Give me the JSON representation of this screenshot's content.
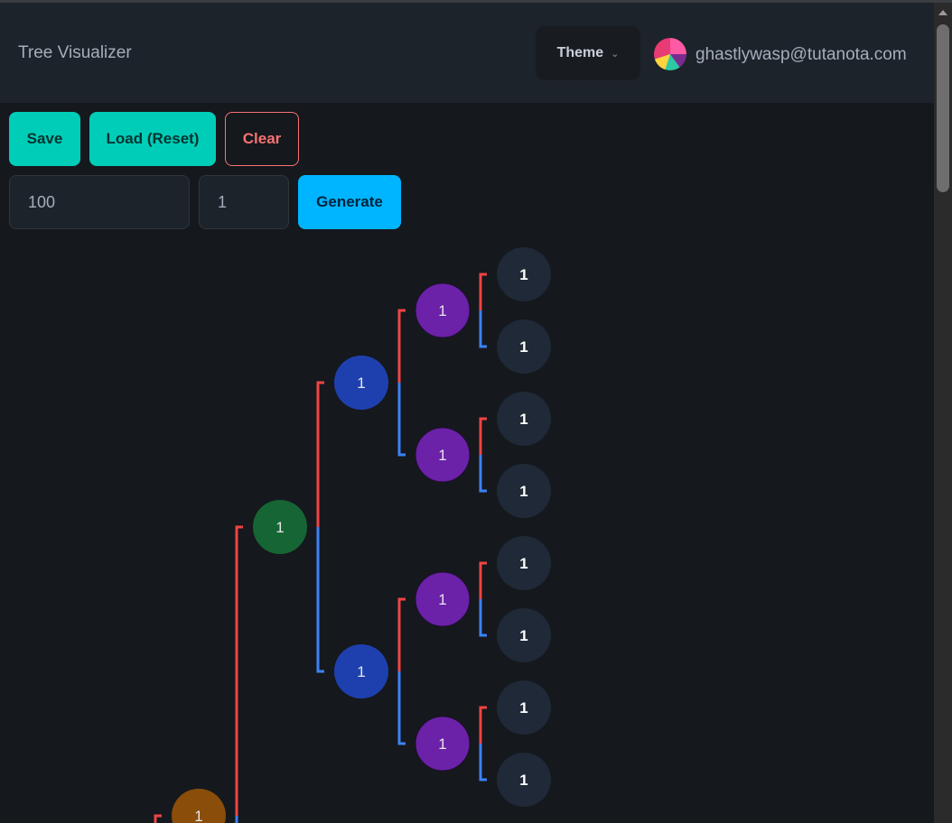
{
  "navbar": {
    "title": "Tree Visualizer",
    "theme_label": "Theme",
    "user_email": "ghastlywasp@tutanota.com"
  },
  "toolbar": {
    "save_label": "Save",
    "load_label": "Load (Reset)",
    "clear_label": "Clear",
    "generate_label": "Generate",
    "size_value": "100",
    "seed_value": "1"
  },
  "colors": {
    "left_branch": "#ef4444",
    "right_branch": "#3b82f6",
    "depth0": "#8a4d0a",
    "depth1": "#166534",
    "depth2": "#1e40af",
    "depth3": "#6b21a8",
    "depth4": "#1f2937"
  },
  "tree": {
    "nodes": [
      {
        "id": "root",
        "value": "1",
        "depth": 0
      },
      {
        "id": "n1",
        "value": "1",
        "depth": 1
      },
      {
        "id": "n2a",
        "value": "1",
        "depth": 2
      },
      {
        "id": "n2b",
        "value": "1",
        "depth": 2
      },
      {
        "id": "n3a",
        "value": "1",
        "depth": 3
      },
      {
        "id": "n3b",
        "value": "1",
        "depth": 3
      },
      {
        "id": "n3c",
        "value": "1",
        "depth": 3
      },
      {
        "id": "n3d",
        "value": "1",
        "depth": 3
      },
      {
        "id": "l1",
        "value": "1",
        "depth": 4
      },
      {
        "id": "l2",
        "value": "1",
        "depth": 4
      },
      {
        "id": "l3",
        "value": "1",
        "depth": 4
      },
      {
        "id": "l4",
        "value": "1",
        "depth": 4
      },
      {
        "id": "l5",
        "value": "1",
        "depth": 4
      },
      {
        "id": "l6",
        "value": "1",
        "depth": 4
      },
      {
        "id": "l7",
        "value": "1",
        "depth": 4
      },
      {
        "id": "l8",
        "value": "1",
        "depth": 4
      }
    ]
  }
}
